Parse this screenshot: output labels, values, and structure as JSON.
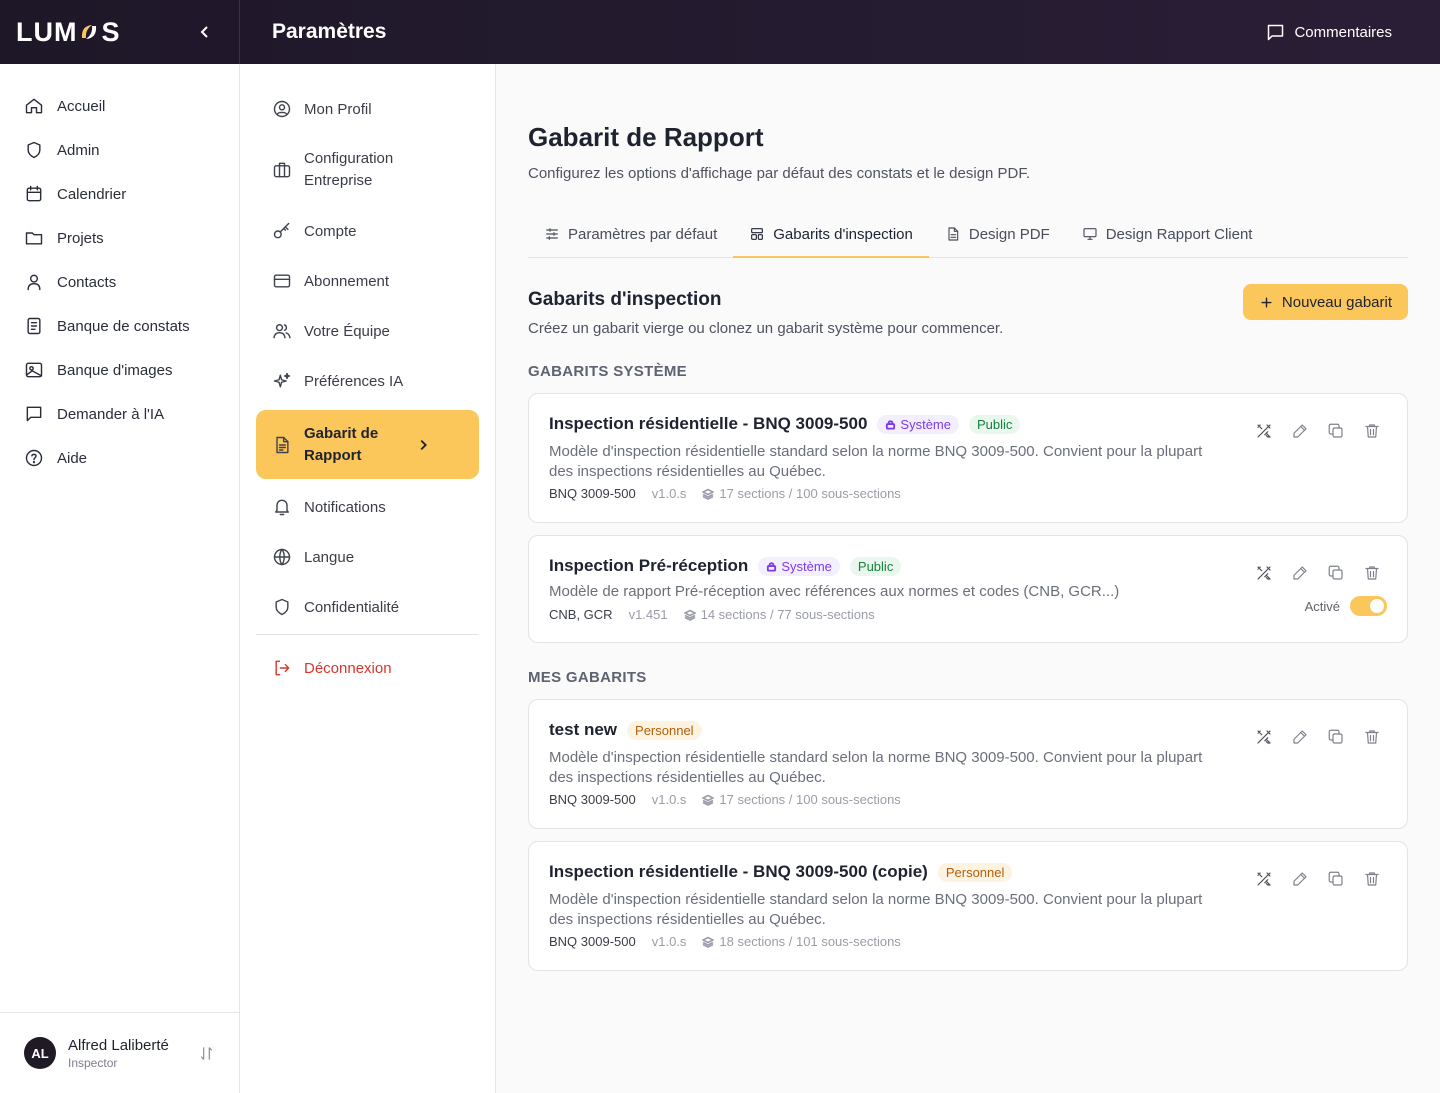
{
  "brand": {
    "logo_prefix": "LUM",
    "logo_suffix": "S"
  },
  "header": {
    "title": "Paramètres",
    "feedback_label": "Commentaires"
  },
  "leftnav": {
    "items": [
      {
        "label": "Accueil",
        "icon": "home-icon"
      },
      {
        "label": "Admin",
        "icon": "shield-icon"
      },
      {
        "label": "Calendrier",
        "icon": "calendar-icon"
      },
      {
        "label": "Projets",
        "icon": "folder-icon"
      },
      {
        "label": "Contacts",
        "icon": "user-icon"
      },
      {
        "label": "Banque de constats",
        "icon": "document-icon"
      },
      {
        "label": "Banque d'images",
        "icon": "image-icon"
      },
      {
        "label": "Demander à l'IA",
        "icon": "chat-icon"
      },
      {
        "label": "Aide",
        "icon": "help-icon"
      }
    ],
    "user": {
      "initials": "AL",
      "name": "Alfred Laliberté",
      "role": "Inspector"
    }
  },
  "settingsnav": {
    "items": [
      {
        "label": "Mon Profil",
        "icon": "user-circle-icon"
      },
      {
        "label": "Configuration Entreprise",
        "icon": "briefcase-icon"
      },
      {
        "label": "Compte",
        "icon": "key-icon"
      },
      {
        "label": "Abonnement",
        "icon": "credit-card-icon"
      },
      {
        "label": "Votre Équipe",
        "icon": "team-icon"
      },
      {
        "label": "Préférences IA",
        "icon": "sparkles-icon"
      },
      {
        "label": "Gabarit de Rapport",
        "icon": "report-icon",
        "active": true
      },
      {
        "label": "Notifications",
        "icon": "bell-icon"
      },
      {
        "label": "Langue",
        "icon": "globe-icon"
      },
      {
        "label": "Confidentialité",
        "icon": "shield-icon"
      }
    ],
    "logout_label": "Déconnexion"
  },
  "main": {
    "title": "Gabarit de Rapport",
    "subtitle": "Configurez les options d'affichage par défaut des constats et le design PDF.",
    "tabs": [
      {
        "label": "Paramètres par défaut",
        "icon": "sliders-icon"
      },
      {
        "label": "Gabarits d'inspection",
        "icon": "layout-icon",
        "active": true
      },
      {
        "label": "Design PDF",
        "icon": "file-icon"
      },
      {
        "label": "Design Rapport Client",
        "icon": "monitor-icon"
      }
    ],
    "section_title": "Gabarits d'inspection",
    "section_subtitle": "Créez un gabarit vierge ou clonez un gabarit système pour commencer.",
    "new_button": "Nouveau gabarit",
    "system_group_label": "GABARITS SYSTÈME",
    "mine_group_label": "MES GABARITS",
    "system_templates": [
      {
        "title": "Inspection résidentielle - BNQ 3009-500",
        "badges": [
          "Système",
          "Public"
        ],
        "description": "Modèle d'inspection résidentielle standard selon la norme BNQ 3009-500. Convient pour la plupart des inspections résidentielles au Québec.",
        "code": "BNQ 3009-500",
        "version": "v1.0.s",
        "counts": "17 sections / 100 sous-sections"
      },
      {
        "title": "Inspection Pré-réception",
        "badges": [
          "Système",
          "Public"
        ],
        "description": "Modèle de rapport Pré-réception avec références aux normes et codes (CNB, GCR...)",
        "code": "CNB, GCR",
        "version": "v1.451",
        "counts": "14 sections / 77 sous-sections",
        "active_label": "Activé",
        "active": true
      }
    ],
    "my_templates": [
      {
        "title": "test new",
        "badges": [
          "Personnel"
        ],
        "description": "Modèle d'inspection résidentielle standard selon la norme BNQ 3009-500. Convient pour la plupart des inspections résidentielles au Québec.",
        "code": "BNQ 3009-500",
        "version": "v1.0.s",
        "counts": "17 sections / 100 sous-sections"
      },
      {
        "title": "Inspection résidentielle - BNQ 3009-500 (copie)",
        "badges": [
          "Personnel"
        ],
        "description": "Modèle d'inspection résidentielle standard selon la norme BNQ 3009-500. Convient pour la plupart des inspections résidentielles au Québec.",
        "code": "BNQ 3009-500",
        "version": "v1.0.s",
        "counts": "18 sections / 101 sous-sections"
      }
    ]
  },
  "colors": {
    "accent": "#fbc65a",
    "topbar": "#1e1728",
    "danger": "#d9352b",
    "system_badge": "#7c3aed",
    "public_badge": "#16803c",
    "personal_badge": "#b45d0a"
  }
}
